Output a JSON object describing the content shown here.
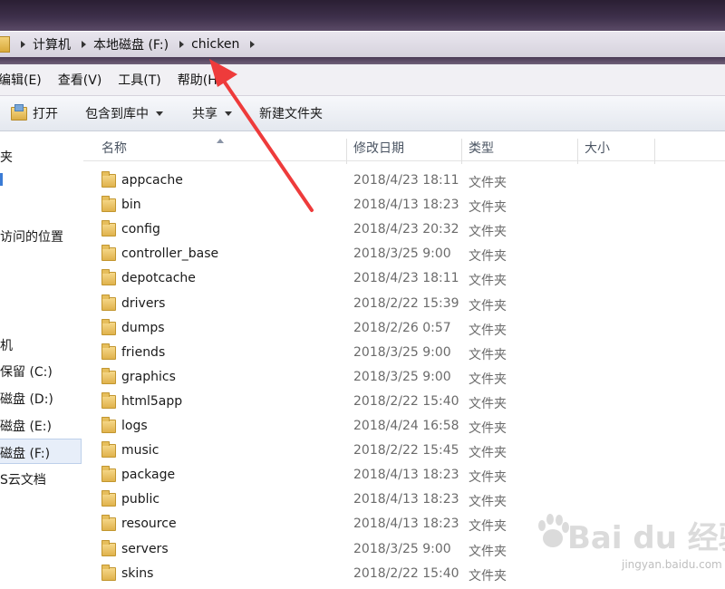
{
  "address_bar": {
    "crumbs": [
      "计算机",
      "本地磁盘 (F:)",
      "chicken"
    ]
  },
  "menu": {
    "items": [
      "编辑(E)",
      "查看(V)",
      "工具(T)",
      "帮助(H)"
    ]
  },
  "toolbar": {
    "open_label": "打开",
    "include_label": "包含到库中",
    "share_label": "共享",
    "new_folder_label": "新建文件夹"
  },
  "nav": {
    "items": [
      "夹",
      "",
      "访问的位置",
      "机",
      "保留 (C:)",
      "磁盘 (D:)",
      "磁盘 (E:)",
      "磁盘 (F:)",
      "S云文档"
    ]
  },
  "columns": {
    "name": "名称",
    "date": "修改日期",
    "type": "类型",
    "size": "大小"
  },
  "files": [
    {
      "name": "appcache",
      "date": "2018/4/23 18:11",
      "type": "文件夹"
    },
    {
      "name": "bin",
      "date": "2018/4/13 18:23",
      "type": "文件夹"
    },
    {
      "name": "config",
      "date": "2018/4/23 20:32",
      "type": "文件夹"
    },
    {
      "name": "controller_base",
      "date": "2018/3/25 9:00",
      "type": "文件夹"
    },
    {
      "name": "depotcache",
      "date": "2018/4/23 18:11",
      "type": "文件夹"
    },
    {
      "name": "drivers",
      "date": "2018/2/22 15:39",
      "type": "文件夹"
    },
    {
      "name": "dumps",
      "date": "2018/2/26 0:57",
      "type": "文件夹"
    },
    {
      "name": "friends",
      "date": "2018/3/25 9:00",
      "type": "文件夹"
    },
    {
      "name": "graphics",
      "date": "2018/3/25 9:00",
      "type": "文件夹"
    },
    {
      "name": "html5app",
      "date": "2018/2/22 15:40",
      "type": "文件夹"
    },
    {
      "name": "logs",
      "date": "2018/4/24 16:58",
      "type": "文件夹"
    },
    {
      "name": "music",
      "date": "2018/2/22 15:45",
      "type": "文件夹"
    },
    {
      "name": "package",
      "date": "2018/4/13 18:23",
      "type": "文件夹"
    },
    {
      "name": "public",
      "date": "2018/4/13 18:23",
      "type": "文件夹"
    },
    {
      "name": "resource",
      "date": "2018/4/13 18:23",
      "type": "文件夹"
    },
    {
      "name": "servers",
      "date": "2018/3/25 9:00",
      "type": "文件夹"
    },
    {
      "name": "skins",
      "date": "2018/2/22 15:40",
      "type": "文件夹"
    }
  ],
  "watermark": {
    "logo": "Bai du 经验",
    "site": "jingyan.baidu.com"
  },
  "colors": {
    "annotation_arrow": "#ee3b3b",
    "selection": "#e7eef9"
  }
}
